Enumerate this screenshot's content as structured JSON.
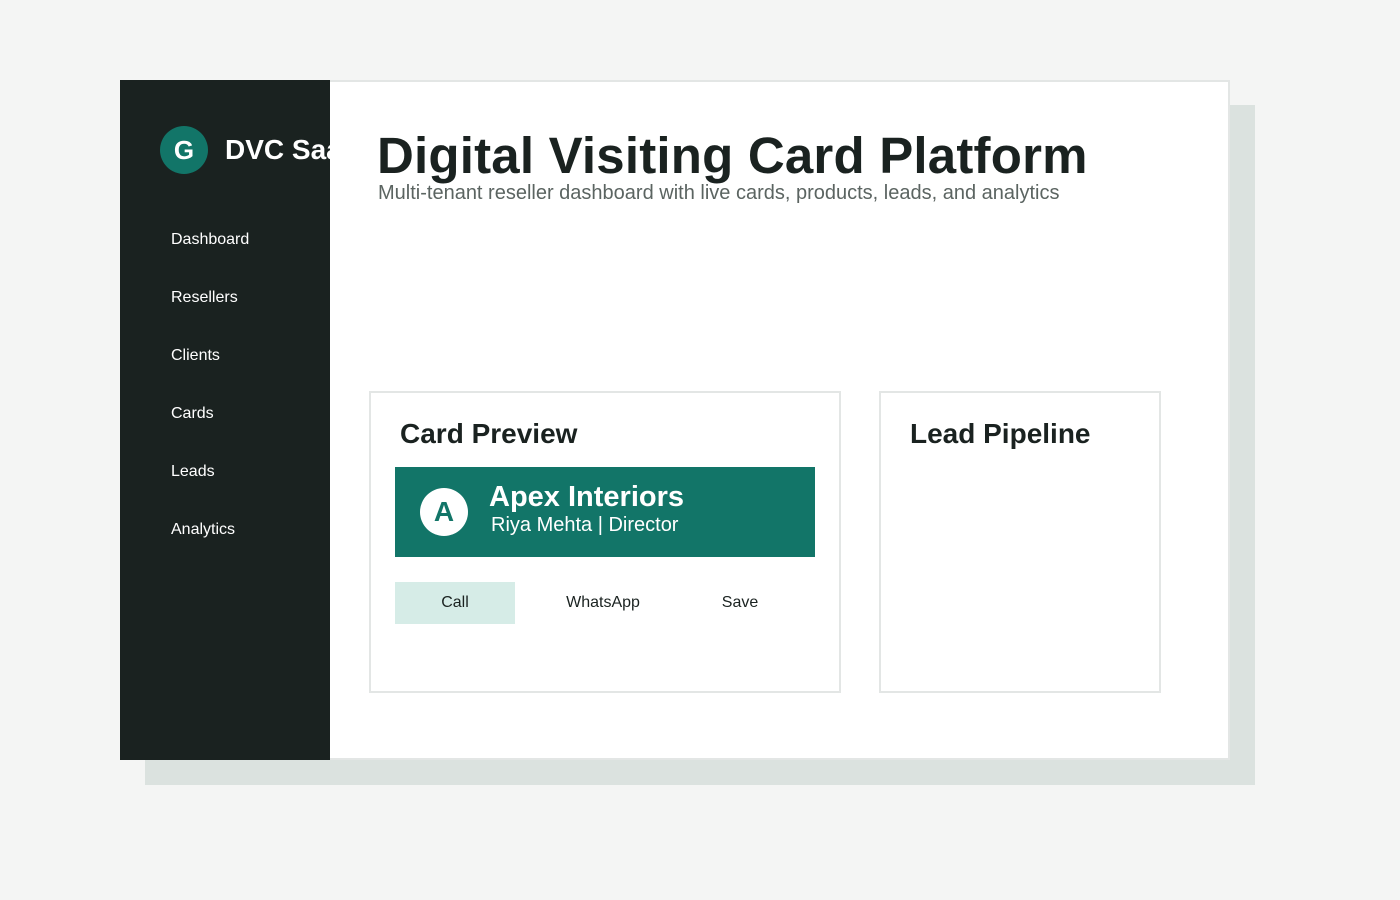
{
  "brand": {
    "logo_letter": "G",
    "name": "DVC SaaS"
  },
  "sidebar": {
    "items": [
      {
        "label": "Dashboard"
      },
      {
        "label": "Resellers"
      },
      {
        "label": "Clients"
      },
      {
        "label": "Cards"
      },
      {
        "label": "Leads"
      },
      {
        "label": "Analytics"
      }
    ]
  },
  "header": {
    "title": "Digital Visiting Card Platform",
    "subtitle": "Multi-tenant reseller dashboard with live cards, products, leads, and analytics"
  },
  "card_preview": {
    "title": "Card Preview",
    "avatar_letter": "A",
    "company": "Apex Interiors",
    "person": "Riya Mehta | Director",
    "actions": {
      "call": "Call",
      "whatsapp": "WhatsApp",
      "save": "Save"
    }
  },
  "lead_pipeline": {
    "title": "Lead Pipeline"
  },
  "colors": {
    "accent": "#127568",
    "sidebar_bg": "#1a2220",
    "call_button_bg": "#d6ece7",
    "page_bg": "#f4f5f4"
  }
}
